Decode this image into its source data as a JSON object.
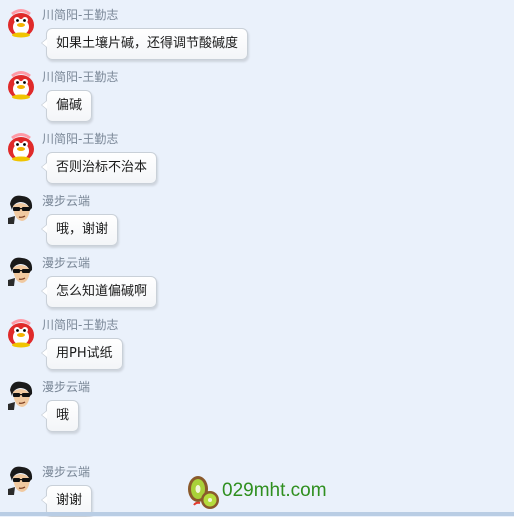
{
  "messages": [
    {
      "sender": "川简阳-王勤志",
      "text": "如果土壤片碱，还得调节酸碱度",
      "avatar": "red-penguin-avatar"
    },
    {
      "sender": "川简阳-王勤志",
      "text": "偏碱",
      "avatar": "red-penguin-avatar"
    },
    {
      "sender": "川简阳-王勤志",
      "text": "否则治标不治本",
      "avatar": "red-penguin-avatar"
    },
    {
      "sender": "漫步云端",
      "text": "哦，谢谢",
      "avatar": "sunglasses-man-avatar"
    },
    {
      "sender": "漫步云端",
      "text": "怎么知道偏碱啊",
      "avatar": "sunglasses-man-avatar"
    },
    {
      "sender": "川简阳-王勤志",
      "text": "用PH试纸",
      "avatar": "red-penguin-avatar"
    },
    {
      "sender": "漫步云端",
      "text": "哦",
      "avatar": "sunglasses-man-avatar"
    },
    {
      "sender": "漫步云端",
      "text": "谢谢",
      "avatar": "sunglasses-man-avatar"
    }
  ],
  "watermark": {
    "text": "029mht.com",
    "icon": "kiwi-fruit-logo-icon"
  },
  "colors": {
    "sender": "#7a8797",
    "watermark": "#2f8f1f",
    "background": "#eaf1fb"
  }
}
